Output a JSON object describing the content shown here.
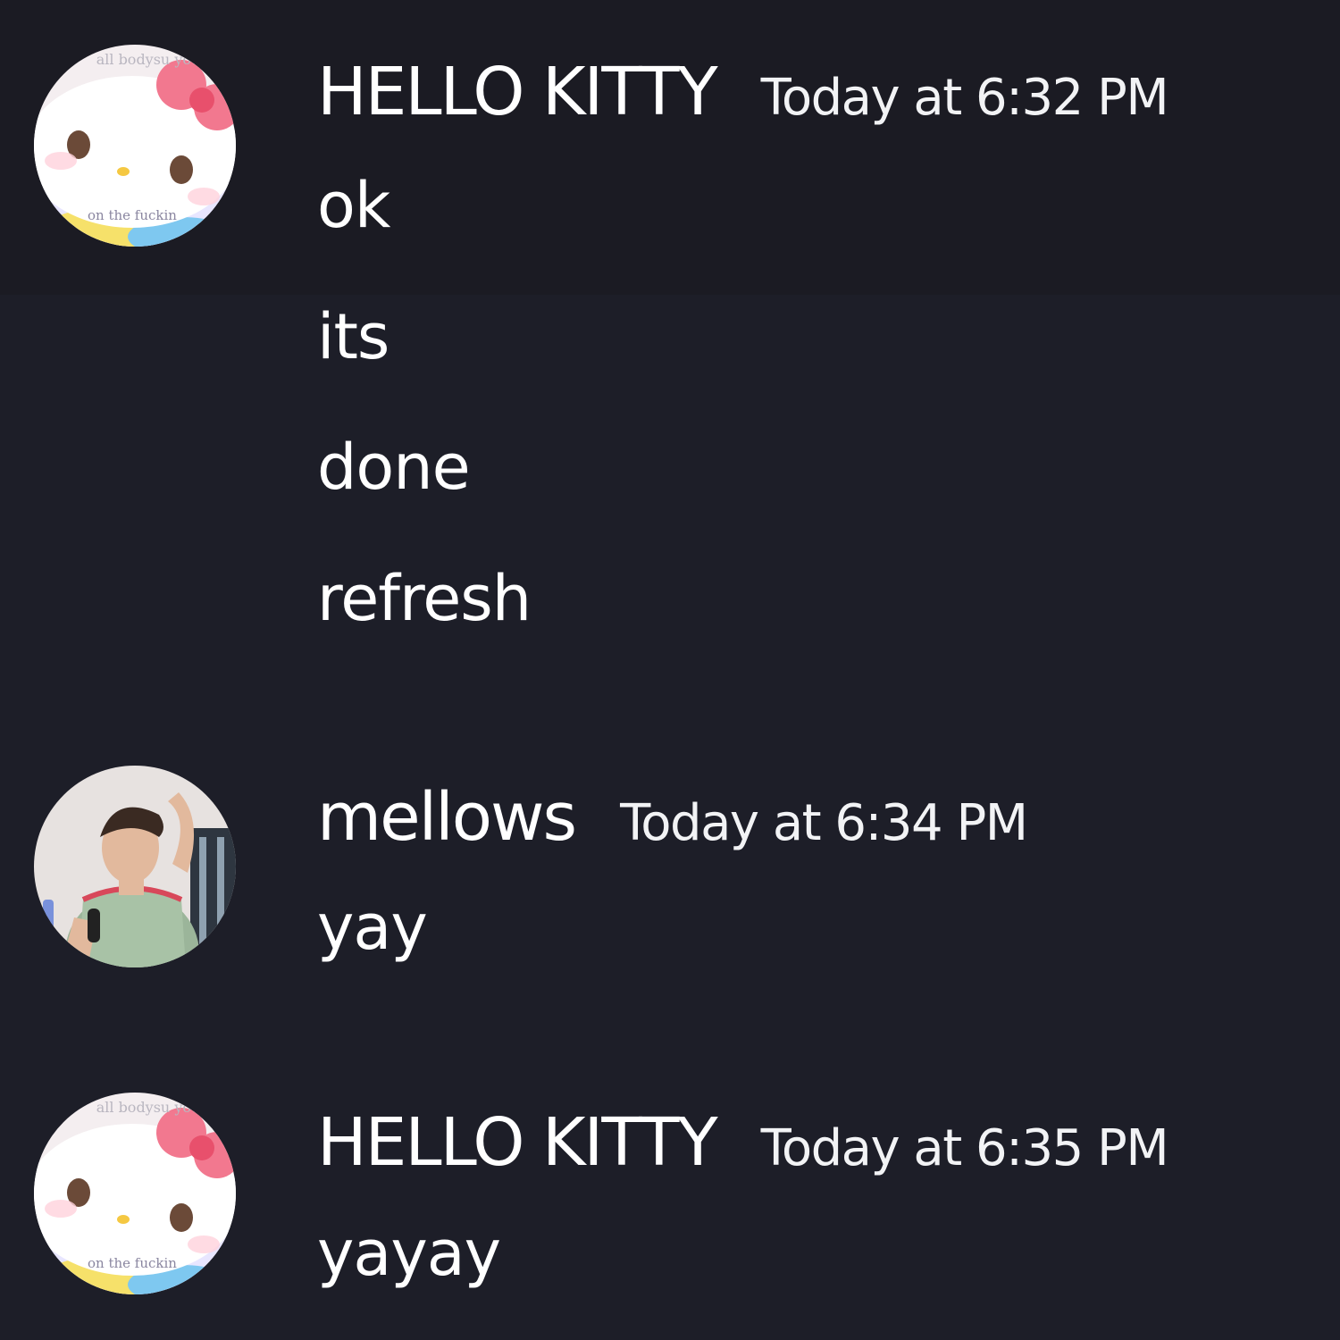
{
  "colors": {
    "background": "#1d1e28",
    "text": "#ffffff"
  },
  "messages": [
    {
      "author": "HELLO KITTY",
      "avatar_icon": "hello-kitty-avatar",
      "avatar_caption_top": "all bodysu you",
      "avatar_caption_bottom": "on the fuckin",
      "timestamp": "Today at 6:32 PM",
      "lines": [
        "ok",
        "its",
        "done",
        "refresh"
      ]
    },
    {
      "author": "mellows",
      "avatar_icon": "person-photo-avatar",
      "timestamp": "Today at 6:34 PM",
      "lines": [
        "yay"
      ]
    },
    {
      "author": "HELLO KITTY",
      "avatar_icon": "hello-kitty-avatar",
      "avatar_caption_top": "all bodysu you",
      "avatar_caption_bottom": "on the fuckin",
      "timestamp": "Today at 6:35 PM",
      "lines": [
        "yayay"
      ]
    }
  ]
}
